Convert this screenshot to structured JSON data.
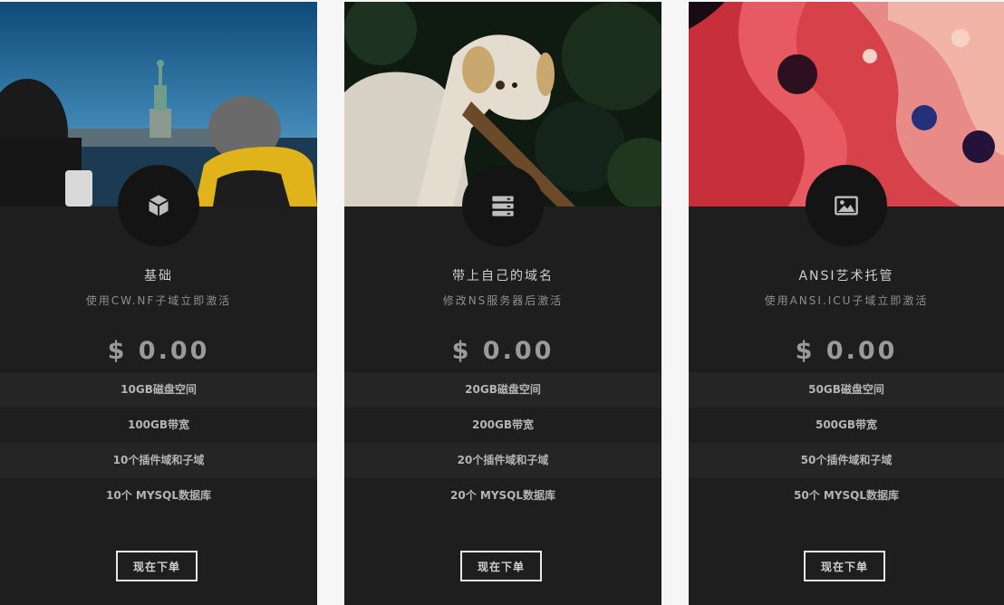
{
  "plans": [
    {
      "title": "基础",
      "subtitle": "使用CW.NF子域立即激活",
      "price": "$ 0.00",
      "icon": "cube-icon",
      "photo": "statue-of-liberty-photo",
      "features": [
        "10GB磁盘空间",
        "100GB带宽",
        "10个插件域和子域",
        "10个 MYSQL数据库"
      ],
      "button": "现在下单"
    },
    {
      "title": "带上自己的域名",
      "subtitle": "修改NS服务器后激活",
      "price": "$ 0.00",
      "icon": "server-icon",
      "photo": "dog-with-stick-photo",
      "features": [
        "20GB磁盘空间",
        "200GB带宽",
        "20个插件域和子域",
        "20个 MYSQL数据库"
      ],
      "button": "现在下单"
    },
    {
      "title": "ANSI艺术托管",
      "subtitle": "使用ANSI.ICU子域立即激活",
      "price": "$ 0.00",
      "icon": "image-icon",
      "photo": "abstract-fluid-art-photo",
      "features": [
        "50GB磁盘空间",
        "500GB带宽",
        "50个插件域和子域",
        "50个 MYSQL数据库"
      ],
      "button": "现在下单"
    }
  ],
  "colors": {
    "card_bg": "#1e1e1e",
    "row_alt": "#252525",
    "badge_bg": "#141414",
    "page_bg": "#f6f6f6"
  }
}
